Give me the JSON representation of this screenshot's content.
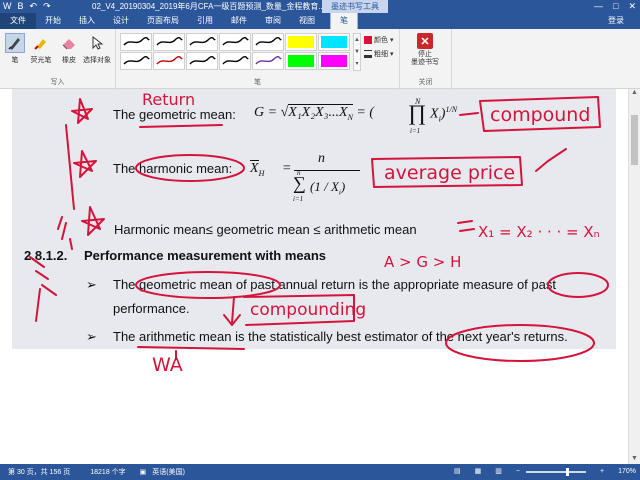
{
  "titlebar": {
    "quick_access": [
      "W",
      "B",
      "↶",
      "↷"
    ],
    "doc_title": "02_V4_20190304_2019年6月CFA一级百题预测_数量_金程教育...",
    "context_tools": "墨迹书写工具",
    "window_buttons": [
      "—",
      "□",
      "✕"
    ]
  },
  "tabs": {
    "file": "文件",
    "items": [
      "开始",
      "插入",
      "设计",
      "页面布局",
      "引用",
      "邮件",
      "审阅",
      "视图"
    ],
    "context_active": "笔",
    "login": "登录"
  },
  "ribbon": {
    "write_group": {
      "label": "写入",
      "buttons": [
        {
          "label": "笔",
          "icon": "pen-icon"
        },
        {
          "label": "荧光笔",
          "icon": "highlighter-icon"
        },
        {
          "label": "橡皮",
          "icon": "eraser-icon"
        },
        {
          "label": "选择对象",
          "icon": "select-cursor-icon"
        }
      ]
    },
    "pens_group": {
      "label": "笔",
      "pens": [
        {
          "color": "#000000",
          "style": "pen"
        },
        {
          "color": "#000000",
          "style": "pen"
        },
        {
          "color": "#000000",
          "style": "pen"
        },
        {
          "color": "#000000",
          "style": "pen"
        },
        {
          "color": "#000000",
          "style": "pen"
        },
        {
          "color": "#ffff00",
          "style": "highlight"
        },
        {
          "color": "#00e5ff",
          "style": "highlight"
        },
        {
          "color": "#000000",
          "style": "pen"
        },
        {
          "color": "#c00000",
          "style": "pen"
        },
        {
          "color": "#000000",
          "style": "pen"
        },
        {
          "color": "#000000",
          "style": "pen"
        },
        {
          "color": "#7030a0",
          "style": "pen"
        },
        {
          "color": "#00ff00",
          "style": "highlight"
        },
        {
          "color": "#ff00ff",
          "style": "highlight"
        }
      ],
      "color_label": "颜色",
      "thickness_label": "粗细"
    },
    "close_group": {
      "label": "关闭",
      "stop_label": "停止\n墨迹书写"
    }
  },
  "document": {
    "geo_label": "The geometric mean:",
    "geo_formula_lhs": "G = ",
    "geo_formula_radical": "X₁X₂X₃...X",
    "geo_formula_sub": "N",
    "geo_formula_eq": "= (",
    "geo_formula_prod": "∏",
    "geo_formula_prod_top": "N",
    "geo_formula_prod_bot": "i=1",
    "geo_formula_xi": "X",
    "geo_formula_xi_sub": "i",
    "geo_formula_exp": ")",
    "geo_formula_exp_sup": "1/N",
    "harm_label": "The harmonic mean:",
    "harm_lhs": "X",
    "harm_lhs_sub": "H",
    "harm_eq": "=",
    "harm_num": "n",
    "harm_den": "(1 / X",
    "harm_den_sub": "i",
    "harm_den_close": ")",
    "harm_sum_top": "n",
    "harm_sum_bot": "i=1",
    "inequality": "Harmonic mean≤ geometric mean ≤ arithmetic mean",
    "section_number": "2.8.1.2.",
    "section_title": "Performance measurement with means",
    "bullet1_line1": "The geometric mean of past annual return is the appropriate measure of past",
    "bullet1_line2": "performance.",
    "bullet2": "The arithmetic mean is the statistically best estimator of the next year's returns."
  },
  "ink": {
    "return": "Return",
    "compound": "compound",
    "average_price": "average price",
    "equality": "X₁ = X₂ · · · = Xₙ",
    "agh": "A > G > H",
    "compounding": "compounding",
    "wa": "WA"
  },
  "statusbar": {
    "page": "第 30 页，共 156 页",
    "words": "18218 个字",
    "lang": "英语(美国)",
    "zoom": "170%"
  },
  "colors": {
    "accent": "#2b579a",
    "ink": "#d4143a"
  }
}
